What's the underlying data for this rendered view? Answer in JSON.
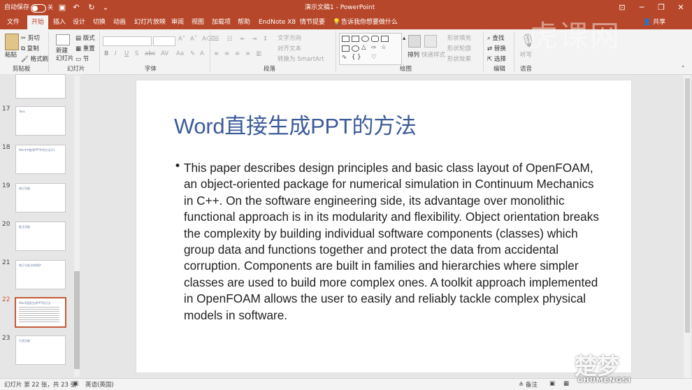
{
  "titlebar": {
    "autosave": "自动保存",
    "autosave_state": "关",
    "doc_title": "演示文稿1 - PowerPoint"
  },
  "tabs": [
    "文件",
    "开始",
    "插入",
    "设计",
    "切换",
    "动画",
    "幻灯片放映",
    "审阅",
    "视图",
    "加载项",
    "帮助",
    "EndNote X8",
    "情节提要"
  ],
  "tellme": "告诉我你想要做什么",
  "share": "共享",
  "ribbon": {
    "clipboard": {
      "group": "剪贴板",
      "paste": "粘贴",
      "cut": "剪切",
      "copy": "复制",
      "format_painter": "格式刷"
    },
    "slides": {
      "group": "幻灯片",
      "new_slide": "新建\n幻灯片",
      "layout": "版式",
      "reset": "重置",
      "section": "节"
    },
    "font": {
      "group": "字体"
    },
    "paragraph": {
      "group": "段落",
      "text_direction": "文字方向",
      "align_text": "对齐文本",
      "smartart": "转换为 SmartArt"
    },
    "drawing": {
      "group": "绘图",
      "arrange": "排列",
      "quick_styles": "快速样式",
      "shape_fill": "形状填充",
      "shape_outline": "形状轮廓",
      "shape_effects": "形状效果"
    },
    "editing": {
      "group": "编辑",
      "find": "查找",
      "replace": "替换",
      "select": "选择"
    },
    "voice": {
      "group": "语音",
      "dictate": "听写"
    }
  },
  "thumbnails": [
    {
      "num": "17",
      "text": "Tees"
    },
    {
      "num": "18",
      "text": "Word中使用PPT中的方法(1)"
    },
    {
      "num": "19",
      "text": "修订功能"
    },
    {
      "num": "20",
      "text": "批注功能"
    },
    {
      "num": "21",
      "text": "修订与批注的保护"
    },
    {
      "num": "22",
      "text": "Word直接生成PPT的方法"
    },
    {
      "num": "23",
      "text": "只读功能"
    }
  ],
  "slide": {
    "title": "Word直接生成PPT的方法",
    "bullet": "•",
    "body": "This paper describes design principles and basic class layout of OpenFOAM, an object-oriented package for numerical simulation in Continuum Mechanics in C++. On the software engineering side, its advantage over monolithic functional approach is in its modularity and flexibility. Object orientation breaks the complexity by building individual software components (classes) which group data and functions together and protect the data from accidental corruption. Components are built in families and hierarchies where simpler classes are used to build more complex ones. A toolkit approach implemented in OpenFOAM allows the user to easily and reliably tackle complex physical models in software."
  },
  "status": {
    "slide_info": "幻灯片 第 22 张，共 23 张",
    "language": "英语(英国)",
    "notes": "备注"
  },
  "watermarks": {
    "top": "虎课网",
    "logo": "楚梦",
    "logo_sub": "CHUMENGSI"
  },
  "colors": {
    "accent": "#b7472a",
    "title_blue": "#3c5b99"
  }
}
